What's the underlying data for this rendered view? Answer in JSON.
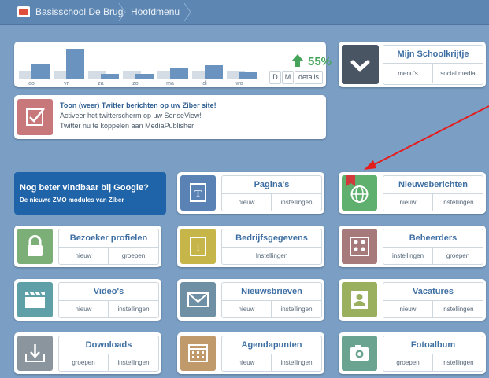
{
  "breadcrumb": {
    "site": "Basisschool De Brug",
    "page": "Hoofdmenu"
  },
  "stats": {
    "days": [
      "do",
      "vr",
      "za",
      "zo",
      "ma",
      "di",
      "wo"
    ],
    "visits_level": [
      0.45,
      0.95,
      0.15,
      0.15,
      0.32,
      0.42,
      0.2
    ],
    "baseline_level": [
      0.25,
      0.25,
      0.25,
      0.25,
      0.25,
      0.25,
      0.25
    ],
    "change_pct": "55%",
    "btn_d": "D",
    "btn_m": "M",
    "btn_details": "details",
    "accent": "#46a45a"
  },
  "schoolkrijtje": {
    "title": "Mijn Schoolkrijtje",
    "action1": "menu's",
    "action2": "social media"
  },
  "twitter": {
    "line1": "Toon (weer) Twitter berichten op uw Ziber site!",
    "line2": "Activeer het twitterscherm op uw SenseView!",
    "line3": "Twitter nu te koppelen aan MediaPublisher"
  },
  "promo": {
    "title": "Nog beter vindbaar bij Google?",
    "subtitle": "De nieuwe ZMO modules van Ziber"
  },
  "tiles": {
    "paginas": {
      "title": "Pagina's",
      "a1": "nieuw",
      "a2": "instellingen",
      "color": "#5b82b5"
    },
    "nieuws": {
      "title": "Nieuwsberichten",
      "a1": "nieuw",
      "a2": "instellingen",
      "color": "#5faf6e"
    },
    "bezoeker": {
      "title": "Bezoeker profielen",
      "a1": "nieuw",
      "a2": "groepen",
      "color": "#7caf78"
    },
    "bedrijf": {
      "title": "Bedrijfsgegevens",
      "a1": "Instellingen",
      "color": "#c6b64a"
    },
    "beheerders": {
      "title": "Beheerders",
      "a1": "instellingen",
      "a2": "groepen",
      "color": "#a6797b"
    },
    "videos": {
      "title": "Video's",
      "a1": "nieuw",
      "a2": "instellingen",
      "color": "#5fa0a8"
    },
    "nieuwsbrieven": {
      "title": "Nieuwsbrieven",
      "a1": "nieuw",
      "a2": "instellingen",
      "color": "#6e8fa4"
    },
    "vacatures": {
      "title": "Vacatures",
      "a1": "nieuw",
      "a2": "instellingen",
      "color": "#9ab05e"
    },
    "downloads": {
      "title": "Downloads",
      "a1": "groepen",
      "a2": "instellingen",
      "color": "#8b959e"
    },
    "agenda": {
      "title": "Agendapunten",
      "a1": "nieuw",
      "a2": "instellingen",
      "color": "#c09a6b"
    },
    "foto": {
      "title": "Fotoalbum",
      "a1": "groepen",
      "a2": "instellingen",
      "color": "#6aa390"
    }
  }
}
